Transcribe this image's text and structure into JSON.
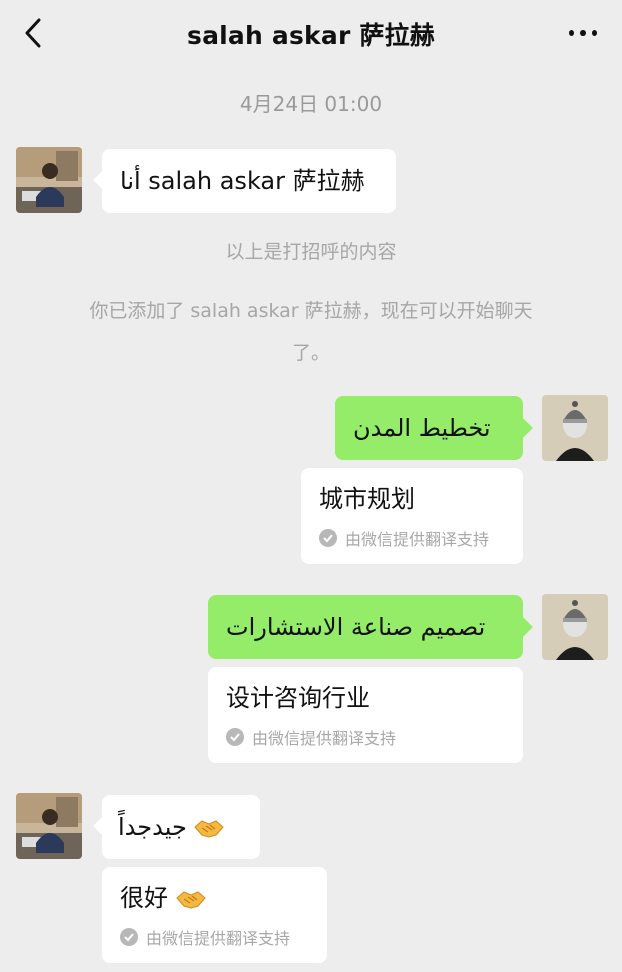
{
  "header": {
    "title": "salah askar 萨拉赫"
  },
  "timestamp": "4月24日 01:00",
  "messages": {
    "greeting": "أنا salah askar 萨拉赫",
    "system_1": "以上是打招呼的内容",
    "system_2_line1": "你已添加了 salah askar 萨拉赫，现在可以开始聊天",
    "system_2_line2": "了。",
    "msg1": "تخطيط المدن",
    "msg1_translation": "城市规划",
    "msg2": "تصميم صناعة الاستشارات",
    "msg2_translation": "设计咨询行业",
    "msg3": "جيدجداً",
    "msg3_translation": "很好",
    "translation_note": "由微信提供翻译支持"
  },
  "icons": {
    "back": "chevron-left-icon",
    "more": "more-dots-icon",
    "check": "check-circle-icon",
    "handshake": "handshake-emoji"
  },
  "colors": {
    "background": "#ededed",
    "sent_bubble": "#95ec69",
    "received_bubble": "#ffffff",
    "muted_text": "#a6a6a6"
  }
}
